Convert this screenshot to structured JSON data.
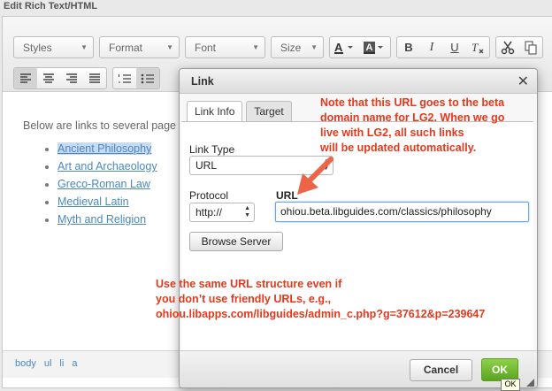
{
  "window_title": "Edit Rich Text/HTML",
  "toolbar": {
    "styles_label": "Styles",
    "format_label": "Format",
    "font_label": "Font",
    "size_label": "Size"
  },
  "content": {
    "intro": "Below are links to several page",
    "links": [
      "Ancient Philosophy",
      "Art and Archaeology",
      "Greco-Roman Law",
      "Medieval Latin",
      "Myth and Religion"
    ]
  },
  "pathbar": {
    "crumbs": [
      "body",
      "ul",
      "li",
      "a"
    ]
  },
  "dialog": {
    "title": "Link",
    "tabs": [
      "Link Info",
      "Target"
    ],
    "link_type_label": "Link Type",
    "link_type_value": "URL",
    "protocol_label": "Protocol",
    "protocol_value": "http://",
    "url_label": "URL",
    "url_value": "ohiou.beta.libguides.com/classics/philosophy",
    "browse_label": "Browse Server",
    "cancel_label": "Cancel",
    "ok_label": "OK"
  },
  "annotations": {
    "note_top": [
      "Note that this URL goes to the beta",
      "domain name for LG2. When we go",
      "live with LG2, all such links",
      "will be updated automatically."
    ],
    "note_bottom": [
      "Use the same URL structure even if",
      "you don’t use friendly URLs, e.g.,",
      "ohiou.libapps.com/libguides/admin_c.php?g=37612&p=239647"
    ],
    "arrow_color": "#ee6446",
    "note_color": "#e4391c"
  },
  "tooltip": "OK",
  "colors": {
    "ok_green": "#6cb52f",
    "link_blue": "#4a88c0"
  }
}
